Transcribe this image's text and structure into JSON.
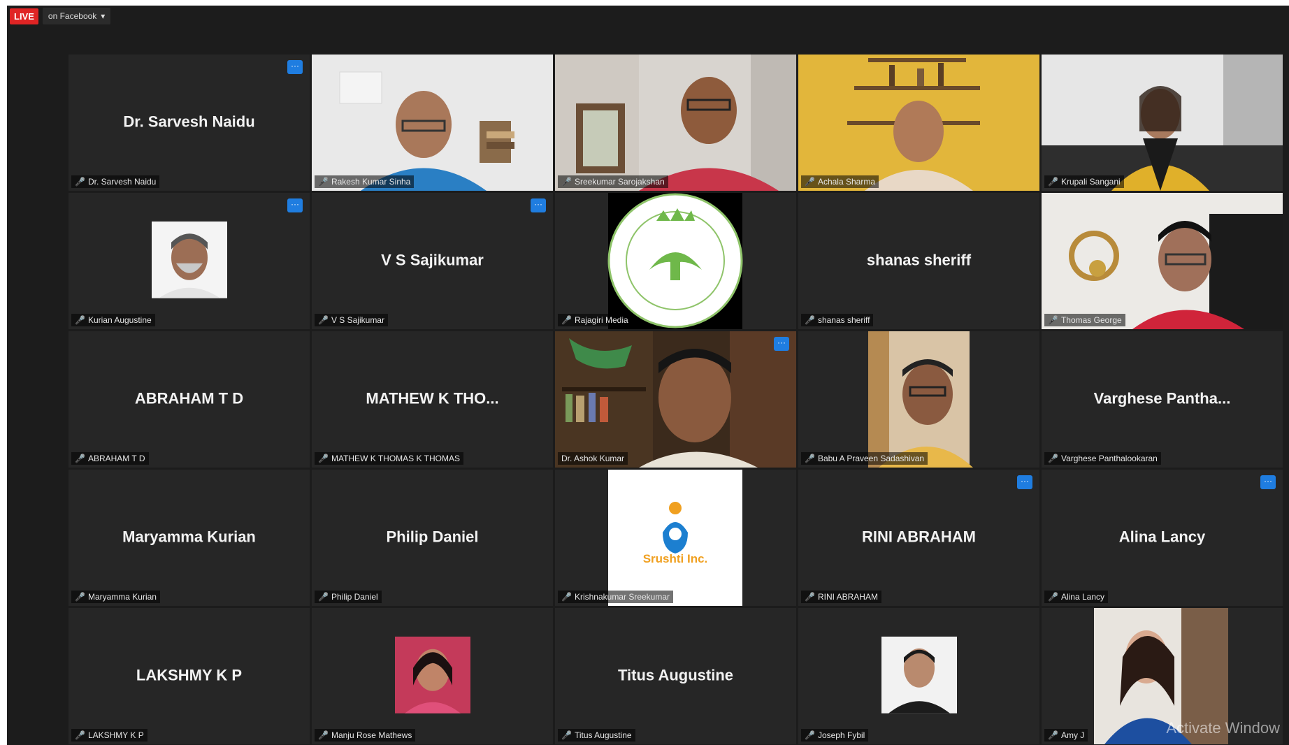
{
  "topbar": {
    "live_label": "LIVE",
    "facebook_label": "on Facebook",
    "dropdown_icon": "chevron-down-icon"
  },
  "participants": [
    {
      "center_name": "Dr. Sarvesh Naidu",
      "tag": "Dr. Sarvesh Naidu"
    },
    {
      "center_name": "",
      "tag": "Rakesh Kumar Sinha"
    },
    {
      "center_name": "",
      "tag": "Sreekumar Sarojakshan"
    },
    {
      "center_name": "",
      "tag": "Achala Sharma"
    },
    {
      "center_name": "",
      "tag": "Krupali Sangani"
    },
    {
      "center_name": "",
      "tag": "Kurian Augustine"
    },
    {
      "center_name": "V S Sajikumar",
      "tag": "V S Sajikumar"
    },
    {
      "center_name": "",
      "tag": "Rajagiri Media"
    },
    {
      "center_name": "shanas sheriff",
      "tag": "shanas sheriff"
    },
    {
      "center_name": "",
      "tag": "Thomas George"
    },
    {
      "center_name": "ABRAHAM T D",
      "tag": "ABRAHAM T D"
    },
    {
      "center_name": "MATHEW K THO...",
      "tag": "MATHEW K THOMAS K THOMAS"
    },
    {
      "center_name": "",
      "tag": "Dr. Ashok Kumar"
    },
    {
      "center_name": "",
      "tag": "Babu A Praveen Sadashivan"
    },
    {
      "center_name": "Varghese Pantha...",
      "tag": "Varghese Panthalookaran"
    },
    {
      "center_name": "Maryamma Kurian",
      "tag": "Maryamma Kurian"
    },
    {
      "center_name": "Philip Daniel",
      "tag": "Philip Daniel"
    },
    {
      "center_name": "",
      "tag": "Krishnakumar Sreekumar",
      "logo_text": "Srushti Inc."
    },
    {
      "center_name": "RINI ABRAHAM",
      "tag": "RINI ABRAHAM"
    },
    {
      "center_name": "Alina Lancy",
      "tag": "Alina Lancy"
    },
    {
      "center_name": "LAKSHMY K P",
      "tag": "LAKSHMY K P"
    },
    {
      "center_name": "",
      "tag": "Manju Rose Mathews"
    },
    {
      "center_name": "Titus Augustine",
      "tag": "Titus Augustine"
    },
    {
      "center_name": "",
      "tag": "Joseph Fybil"
    },
    {
      "center_name": "",
      "tag": "Amy J",
      "watermark": "Activate Window"
    }
  ],
  "colors": {
    "background": "#1c1c1c",
    "tile": "#262626",
    "active_border": "#b9de3a",
    "more_button": "#1f7de0",
    "mute": "#e53935"
  }
}
